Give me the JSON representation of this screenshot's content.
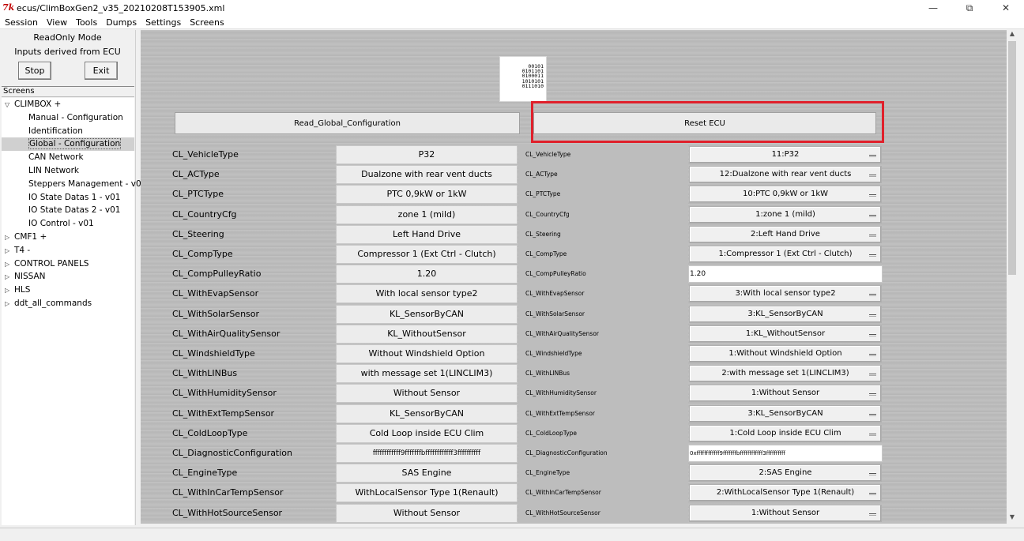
{
  "window": {
    "title": "ecus/ClimBoxGen2_v35_20210208T153905.xml",
    "app_icon": "7k"
  },
  "menu": [
    "Session",
    "View",
    "Tools",
    "Dumps",
    "Settings",
    "Screens"
  ],
  "left": {
    "mode": "ReadOnly Mode",
    "inputs": "Inputs derived from ECU",
    "stop_label": "Stop",
    "exit_label": "Exit",
    "screens_header": "Screens"
  },
  "tree": [
    {
      "label": "CLIMBOX +",
      "level": 0,
      "expanded": true
    },
    {
      "label": "Manual - Configuration",
      "level": 1
    },
    {
      "label": "Identification",
      "level": 1
    },
    {
      "label": "Global - Configuration",
      "level": 1,
      "selected": true
    },
    {
      "label": "CAN Network",
      "level": 1
    },
    {
      "label": "LIN Network",
      "level": 1
    },
    {
      "label": "Steppers Management - v02",
      "level": 1
    },
    {
      "label": "IO State Datas 1 - v01",
      "level": 1
    },
    {
      "label": "IO State Datas 2 - v01",
      "level": 1
    },
    {
      "label": "IO Control - v01",
      "level": 1
    },
    {
      "label": "CMF1 +",
      "level": 0,
      "expanded": false
    },
    {
      "label": "T4 -",
      "level": 0,
      "expanded": false
    },
    {
      "label": "CONTROL PANELS",
      "level": 0,
      "expanded": false
    },
    {
      "label": "NISSAN",
      "level": 0,
      "expanded": false
    },
    {
      "label": "HLS",
      "level": 0,
      "expanded": false
    },
    {
      "label": "ddt_all_commands",
      "level": 0,
      "expanded": false
    }
  ],
  "main": {
    "logo_text": "00101\n0101101\n0100011\n1010101\n0111010",
    "read_button": "Read_Global_Configuration",
    "reset_button": "Reset ECU",
    "rows": [
      {
        "label": "CL_VehicleType",
        "value": "P32",
        "r_label": "CL_VehicleType",
        "r_value": "11:P32",
        "r_type": "select"
      },
      {
        "label": "CL_ACType",
        "value": "Dualzone with rear vent ducts",
        "r_label": "CL_ACType",
        "r_value": "12:Dualzone with rear vent ducts",
        "r_type": "select"
      },
      {
        "label": "CL_PTCType",
        "value": "PTC 0,9kW or 1kW",
        "r_label": "CL_PTCType",
        "r_value": "10:PTC 0,9kW or 1kW",
        "r_type": "select"
      },
      {
        "label": "CL_CountryCfg",
        "value": "zone 1 (mild)",
        "r_label": "CL_CountryCfg",
        "r_value": "1:zone 1 (mild)",
        "r_type": "select"
      },
      {
        "label": "CL_Steering",
        "value": "Left Hand Drive",
        "r_label": "CL_Steering",
        "r_value": "2:Left Hand Drive",
        "r_type": "select"
      },
      {
        "label": "CL_CompType",
        "value": "Compressor 1 (Ext Ctrl - Clutch)",
        "r_label": "CL_CompType",
        "r_value": "1:Compressor 1 (Ext Ctrl - Clutch)",
        "r_type": "select"
      },
      {
        "label": "CL_CompPulleyRatio",
        "value": "1.20",
        "r_label": "CL_CompPulleyRatio",
        "r_value": "1.20",
        "r_type": "input"
      },
      {
        "label": "CL_WithEvapSensor",
        "value": "With local sensor type2",
        "r_label": "CL_WithEvapSensor",
        "r_value": "3:With local sensor type2",
        "r_type": "select"
      },
      {
        "label": "CL_WithSolarSensor",
        "value": "KL_SensorByCAN",
        "r_label": "CL_WithSolarSensor",
        "r_value": "3:KL_SensorByCAN",
        "r_type": "select"
      },
      {
        "label": "CL_WithAirQualitySensor",
        "value": "KL_WithoutSensor",
        "r_label": "CL_WithAirQualitySensor",
        "r_value": "1:KL_WithoutSensor",
        "r_type": "select"
      },
      {
        "label": "CL_WindshieldType",
        "value": "Without Windshield Option",
        "r_label": "CL_WindshieldType",
        "r_value": "1:Without Windshield Option",
        "r_type": "select"
      },
      {
        "label": "CL_WithLINBus",
        "value": "with message set 1(LINCLIM3)",
        "r_label": "CL_WithLINBus",
        "r_value": "2:with message set 1(LINCLIM3)",
        "r_type": "select"
      },
      {
        "label": "CL_WithHumiditySensor",
        "value": "Without Sensor",
        "r_label": "CL_WithHumiditySensor",
        "r_value": "1:Without Sensor",
        "r_type": "select"
      },
      {
        "label": "CL_WithExtTempSensor",
        "value": "KL_SensorByCAN",
        "r_label": "CL_WithExtTempSensor",
        "r_value": "3:KL_SensorByCAN",
        "r_type": "select"
      },
      {
        "label": "CL_ColdLoopType",
        "value": "Cold Loop inside ECU Clim",
        "r_label": "CL_ColdLoopType",
        "r_value": "1:Cold Loop inside ECU Clim",
        "r_type": "select"
      },
      {
        "label": "CL_DiagnosticConfiguration",
        "value": "ffffffffffff9fffffffbffffffffffff3ffffffffff",
        "r_label": "CL_DiagnosticConfiguration",
        "r_value": "0xffffffffffff9fffffffbffffffffffff3ffffffffff",
        "r_type": "input"
      },
      {
        "label": "CL_EngineType",
        "value": "SAS Engine",
        "r_label": "CL_EngineType",
        "r_value": "2:SAS Engine",
        "r_type": "select"
      },
      {
        "label": "CL_WithInCarTempSensor",
        "value": "WithLocalSensor Type 1(Renault)",
        "r_label": "CL_WithInCarTempSensor",
        "r_value": "2:WithLocalSensor Type 1(Renault)",
        "r_type": "select"
      },
      {
        "label": "CL_WithHotSourceSensor",
        "value": "Without Sensor",
        "r_label": "CL_WithHotSourceSensor",
        "r_value": "1:Without Sensor",
        "r_type": "select"
      }
    ]
  }
}
